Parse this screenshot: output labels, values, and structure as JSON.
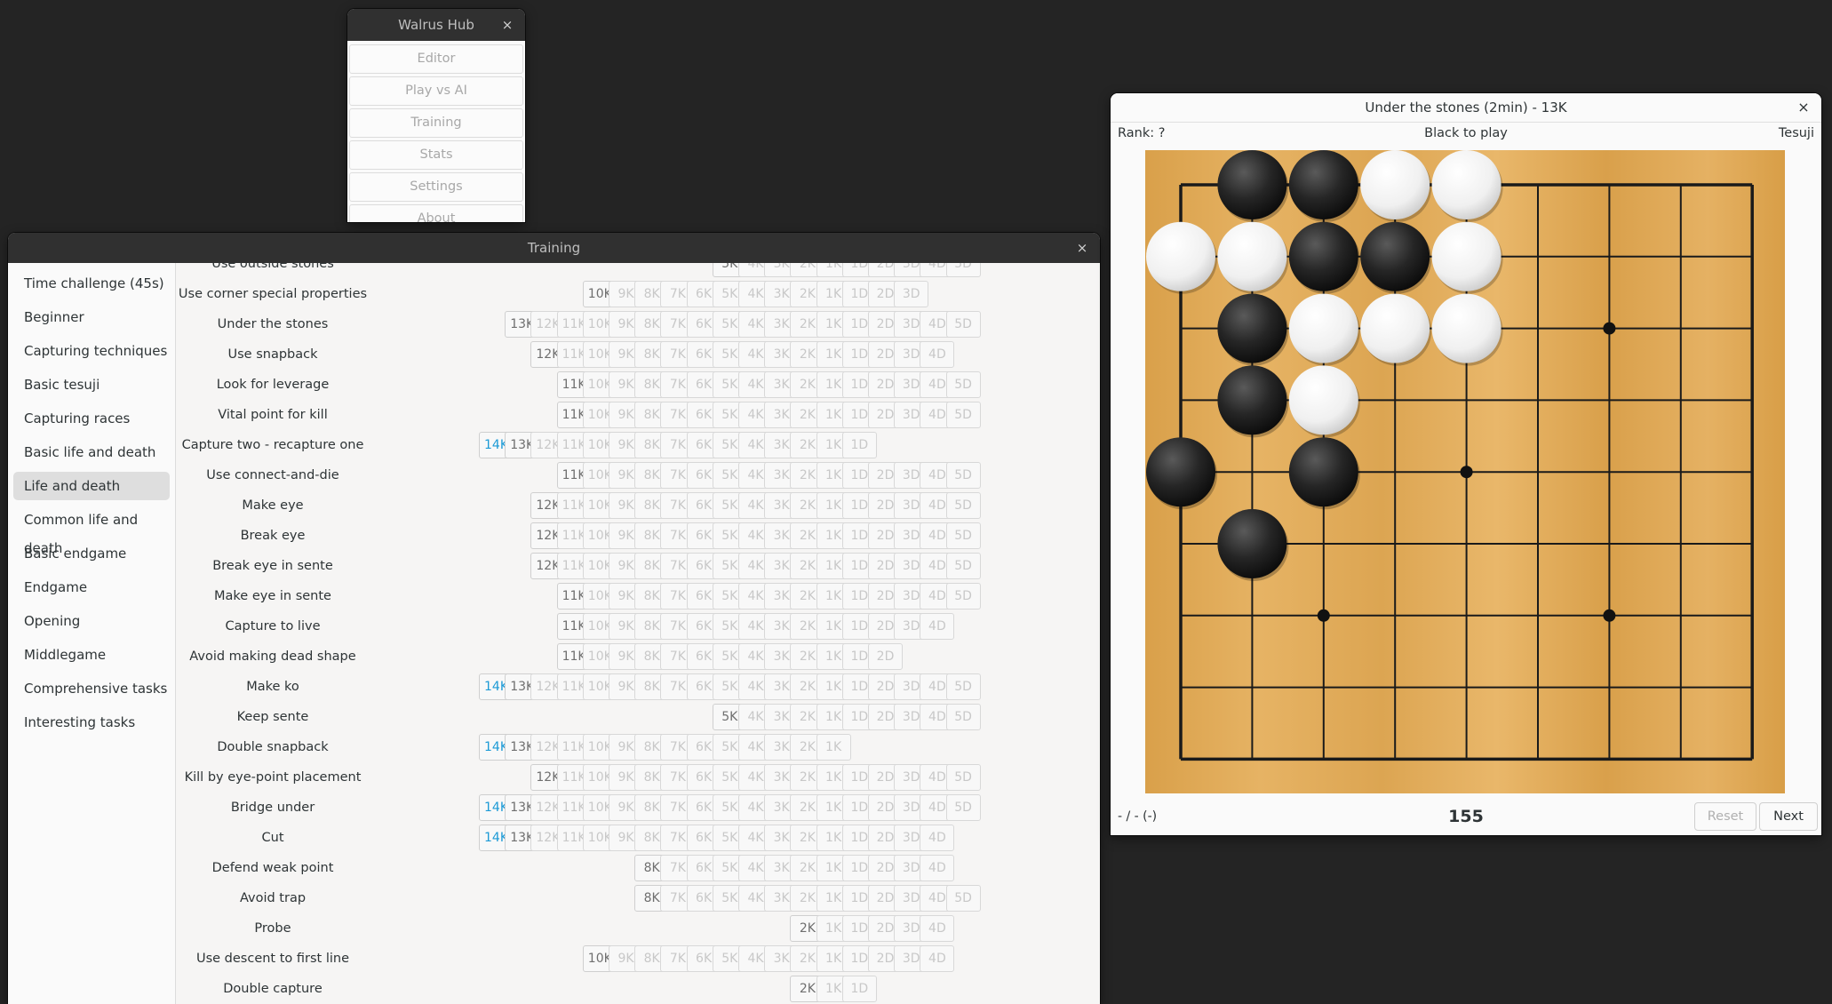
{
  "hub": {
    "title": "Walrus Hub",
    "close": "×",
    "items": [
      "Editor",
      "Play vs AI",
      "Training",
      "Stats",
      "Settings",
      "About"
    ]
  },
  "training": {
    "title": "Training",
    "close": "×",
    "categories": [
      {
        "label": "Time challenge (45s)",
        "selected": false
      },
      {
        "label": "Beginner",
        "selected": false
      },
      {
        "label": "Capturing techniques",
        "selected": false
      },
      {
        "label": "Basic tesuji",
        "selected": false
      },
      {
        "label": "Capturing races",
        "selected": false
      },
      {
        "label": "Basic life and death",
        "selected": false
      },
      {
        "label": "Life and death",
        "selected": true
      },
      {
        "label": "Common life and death",
        "selected": false
      },
      {
        "label": "Basic endgame",
        "selected": false
      },
      {
        "label": "Endgame",
        "selected": false
      },
      {
        "label": "Opening",
        "selected": false
      },
      {
        "label": "Middlegame",
        "selected": false
      },
      {
        "label": "Comprehensive tasks",
        "selected": false
      },
      {
        "label": "Interesting tasks",
        "selected": false
      }
    ],
    "ranks": [
      "14K",
      "13K",
      "12K",
      "11K",
      "10K",
      "9K",
      "8K",
      "7K",
      "6K",
      "5K",
      "4K",
      "3K",
      "2K",
      "1K",
      "1D",
      "2D",
      "3D",
      "4D",
      "5D"
    ],
    "rows": [
      {
        "name": "Use outside stones",
        "start": "5K",
        "end": "5D",
        "unlocked": 1,
        "current": false
      },
      {
        "name": "Use corner special properties",
        "start": "10K",
        "end": "3D",
        "unlocked": 1,
        "current": false
      },
      {
        "name": "Under the stones",
        "start": "13K",
        "end": "5D",
        "unlocked": 1,
        "current": false
      },
      {
        "name": "Use snapback",
        "start": "12K",
        "end": "4D",
        "unlocked": 1,
        "current": false
      },
      {
        "name": "Look for leverage",
        "start": "11K",
        "end": "5D",
        "unlocked": 1,
        "current": false
      },
      {
        "name": "Vital point for kill",
        "start": "11K",
        "end": "5D",
        "unlocked": 1,
        "current": false
      },
      {
        "name": "Capture two - recapture one",
        "start": "14K",
        "end": "1D",
        "unlocked": 2,
        "current": true
      },
      {
        "name": "Use connect-and-die",
        "start": "11K",
        "end": "5D",
        "unlocked": 1,
        "current": false
      },
      {
        "name": "Make eye",
        "start": "12K",
        "end": "5D",
        "unlocked": 1,
        "current": false
      },
      {
        "name": "Break eye",
        "start": "12K",
        "end": "5D",
        "unlocked": 1,
        "current": false
      },
      {
        "name": "Break eye in sente",
        "start": "12K",
        "end": "5D",
        "unlocked": 1,
        "current": false
      },
      {
        "name": "Make eye in sente",
        "start": "11K",
        "end": "5D",
        "unlocked": 1,
        "current": false
      },
      {
        "name": "Capture to live",
        "start": "11K",
        "end": "4D",
        "unlocked": 1,
        "current": false
      },
      {
        "name": "Avoid making dead shape",
        "start": "11K",
        "end": "2D",
        "unlocked": 1,
        "current": false
      },
      {
        "name": "Make ko",
        "start": "14K",
        "end": "5D",
        "unlocked": 2,
        "current": true
      },
      {
        "name": "Keep sente",
        "start": "5K",
        "end": "5D",
        "unlocked": 1,
        "current": false
      },
      {
        "name": "Double snapback",
        "start": "14K",
        "end": "1K",
        "unlocked": 2,
        "current": true
      },
      {
        "name": "Kill by eye-point placement",
        "start": "12K",
        "end": "5D",
        "unlocked": 1,
        "current": false
      },
      {
        "name": "Bridge under",
        "start": "14K",
        "end": "5D",
        "unlocked": 2,
        "current": true
      },
      {
        "name": "Cut",
        "start": "14K",
        "end": "4D",
        "unlocked": 2,
        "current": true
      },
      {
        "name": "Defend weak point",
        "start": "8K",
        "end": "4D",
        "unlocked": 1,
        "current": false
      },
      {
        "name": "Avoid trap",
        "start": "8K",
        "end": "5D",
        "unlocked": 1,
        "current": false
      },
      {
        "name": "Probe",
        "start": "2K",
        "end": "4D",
        "unlocked": 1,
        "current": false
      },
      {
        "name": "Use descent to first line",
        "start": "10K",
        "end": "4D",
        "unlocked": 1,
        "current": false
      },
      {
        "name": "Double capture",
        "start": "2K",
        "end": "1D",
        "unlocked": 1,
        "current": false
      }
    ]
  },
  "problem": {
    "title": "Under the stones (2min) - 13K",
    "close": "×",
    "rank": "Rank: ?",
    "to_play": "Black to play",
    "category": "Tesuji",
    "status": "- / - (-)",
    "counter": "155",
    "reset_label": "Reset",
    "next_label": "Next",
    "board": {
      "size": 9,
      "star_points": [
        [
          6,
          2
        ],
        [
          4,
          4
        ],
        [
          2,
          6
        ],
        [
          6,
          6
        ]
      ],
      "black": [
        [
          1,
          0
        ],
        [
          2,
          0
        ],
        [
          2,
          1
        ],
        [
          3,
          1
        ],
        [
          1,
          2
        ],
        [
          1,
          3
        ],
        [
          0,
          4
        ],
        [
          2,
          4
        ],
        [
          1,
          5
        ]
      ],
      "white": [
        [
          3,
          0
        ],
        [
          4,
          0
        ],
        [
          0,
          1
        ],
        [
          1,
          1
        ],
        [
          4,
          1
        ],
        [
          2,
          2
        ],
        [
          3,
          2
        ],
        [
          4,
          2
        ],
        [
          2,
          3
        ]
      ]
    }
  }
}
